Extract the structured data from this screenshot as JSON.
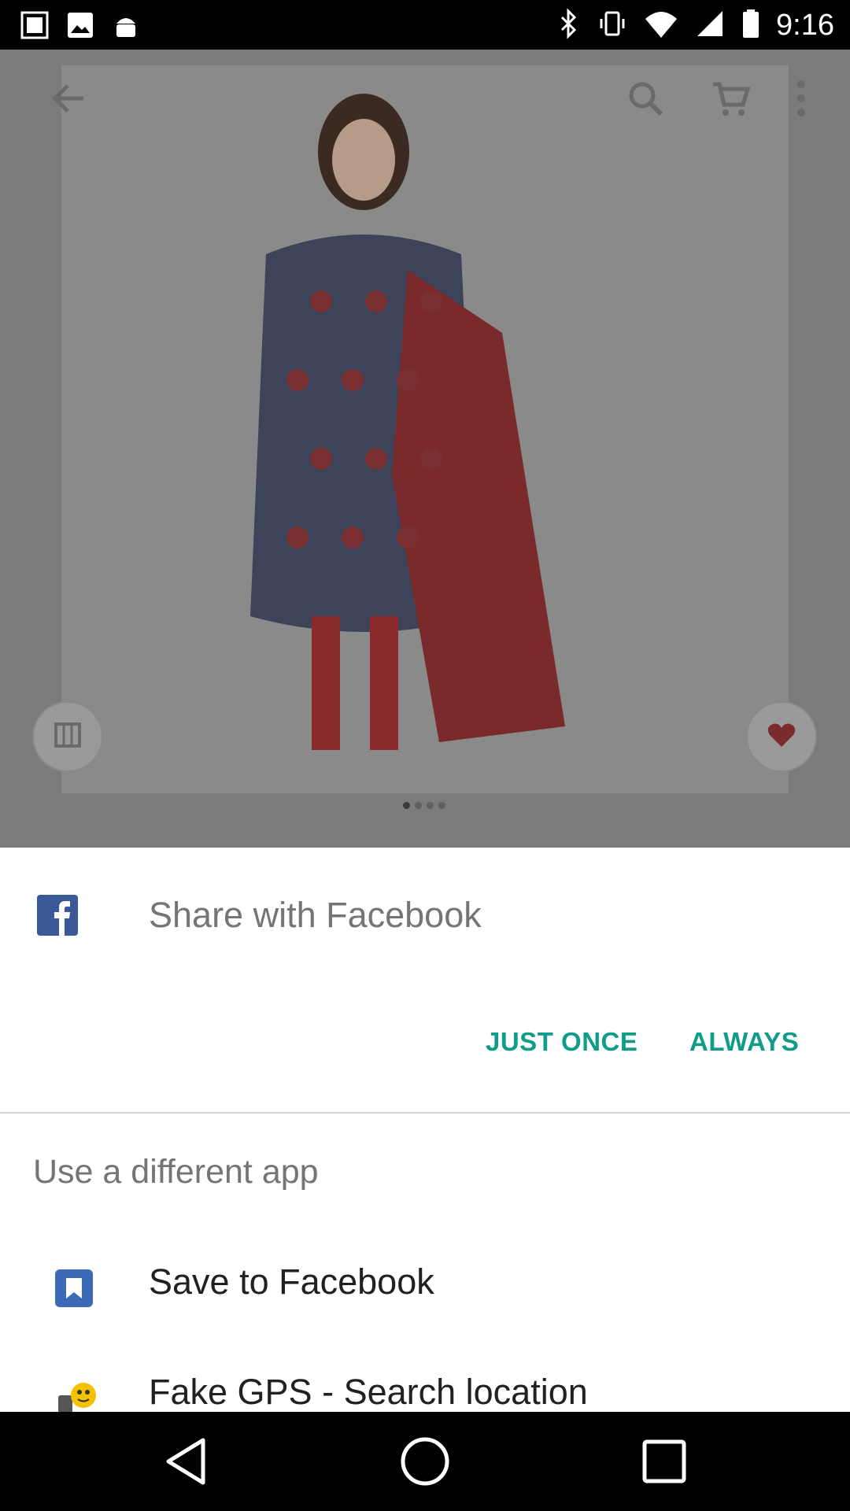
{
  "status_bar": {
    "time": "9:16",
    "icons": [
      "gps-fake-icon",
      "image-icon",
      "android-icon",
      "bluetooth-icon",
      "vibrate-icon",
      "wifi-icon",
      "signal-icon",
      "battery-icon"
    ]
  },
  "background_app": {
    "icons": [
      "back-arrow-icon",
      "search-icon",
      "cart-icon",
      "more-vert-icon",
      "compare-icon",
      "heart-icon"
    ],
    "image_indicator": {
      "count": 4,
      "active_index": 0
    }
  },
  "share_dialog": {
    "title": "Share with Facebook",
    "just_once_label": "JUST ONCE",
    "always_label": "ALWAYS",
    "different_app_title": "Use a different app",
    "apps": [
      {
        "label": "Save to Facebook",
        "icon": "bookmark-icon"
      },
      {
        "label": "Fake GPS - Search location",
        "icon": "fake-gps-app-icon"
      }
    ]
  },
  "colors": {
    "accent": "#0f9d8a",
    "facebook_blue": "#3b5998",
    "scrim": "#7b7b7b"
  }
}
